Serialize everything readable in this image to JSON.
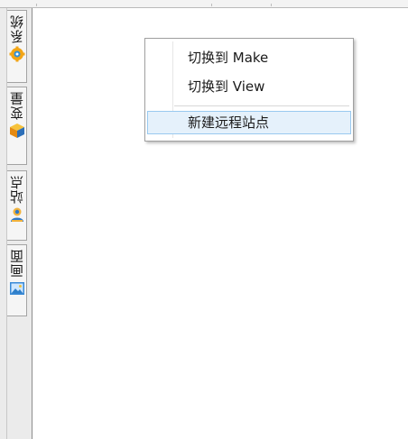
{
  "sidebar": {
    "tabs": [
      {
        "label": "系统",
        "icon": "system-gear-icon"
      },
      {
        "label": "变量",
        "icon": "variable-cube-icon"
      },
      {
        "label": "站点",
        "icon": "site-user-icon"
      },
      {
        "label": "画面",
        "icon": "picture-icon"
      }
    ]
  },
  "context_menu": {
    "items": [
      {
        "label": "切换到 Make"
      },
      {
        "label": "切换到 View"
      },
      {
        "label": "新建远程站点",
        "highlighted": true
      }
    ]
  },
  "colors": {
    "menu_highlight_bg": "#e5f1fb",
    "menu_highlight_border": "#99c9ef",
    "tabbar_bg": "#ebebeb"
  }
}
